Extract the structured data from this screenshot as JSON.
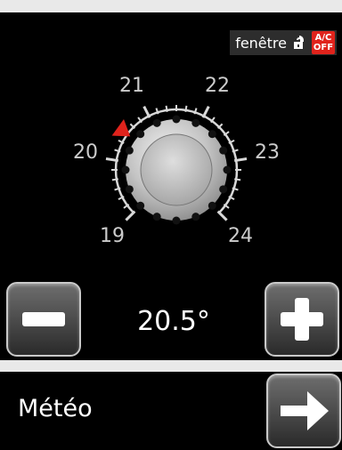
{
  "status": {
    "window_label": "fenêtre",
    "lock_icon": "unlocked-padlock-icon",
    "ac_top": "A/C",
    "ac_bottom": "OFF",
    "ac_color": "#e0231c"
  },
  "dial": {
    "labels": [
      "19",
      "20",
      "21",
      "22",
      "23",
      "24"
    ],
    "setpoint": 20.5,
    "pointer_color": "#e0231c"
  },
  "controls": {
    "minus_icon": "minus-icon",
    "plus_icon": "plus-icon",
    "temperature": "20.5°"
  },
  "meteo": {
    "label": "Météo",
    "arrow_icon": "arrow-right-icon"
  }
}
